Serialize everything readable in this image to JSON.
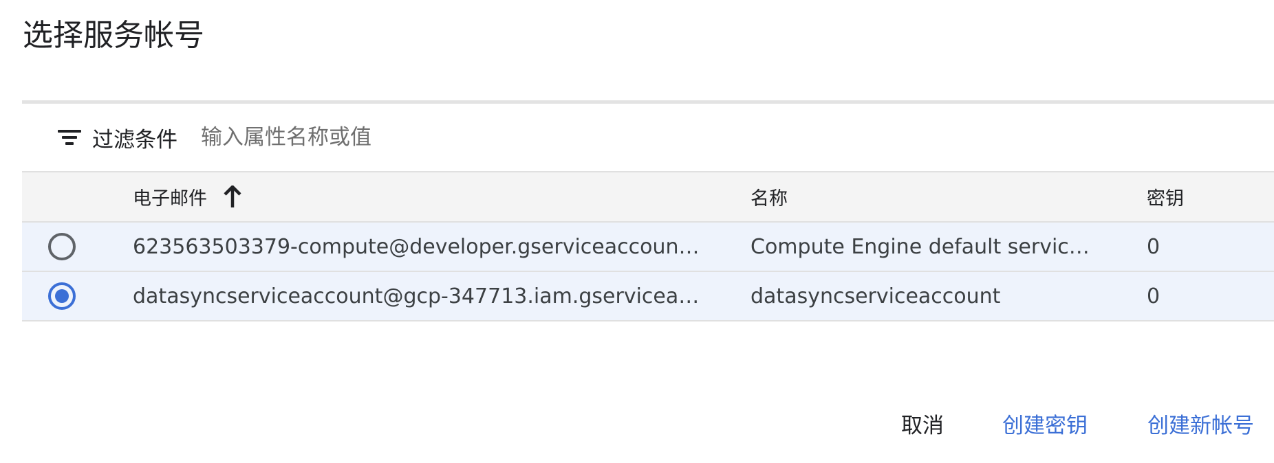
{
  "dialog": {
    "title": "选择服务帐号"
  },
  "filter": {
    "label": "过滤条件",
    "placeholder": "输入属性名称或值",
    "icon": "filter-list-icon"
  },
  "table": {
    "columns": {
      "email": "电子邮件",
      "name": "名称",
      "keys": "密钥"
    },
    "sort": {
      "column": "email",
      "direction": "ascending",
      "icon": "arrow-upward-icon"
    },
    "rows": [
      {
        "email": "623563503379-compute@developer.gserviceaccount.…",
        "name": "Compute Engine default service …",
        "keys": "0",
        "selected": false
      },
      {
        "email": "datasyncserviceaccount@gcp-347713.iam.gserviceac…",
        "name": "datasyncserviceaccount",
        "keys": "0",
        "selected": true
      }
    ]
  },
  "actions": {
    "cancel": "取消",
    "create_key": "创建密钥",
    "create_account": "创建新帐号"
  },
  "colors": {
    "accent": "#3b6fd6",
    "row_background": "#eef3fc",
    "header_background": "#f4f4f4"
  }
}
